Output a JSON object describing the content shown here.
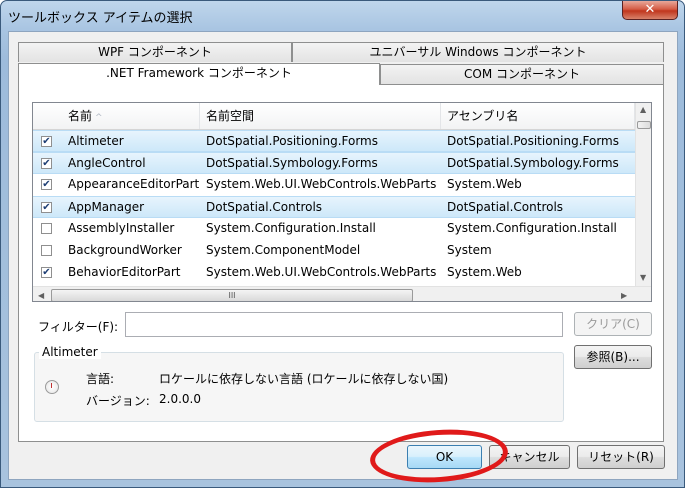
{
  "window": {
    "title": "ツールボックス アイテムの選択",
    "close_label": "✕"
  },
  "tabs": {
    "row1": [
      {
        "label": "WPF コンポーネント"
      },
      {
        "label": "ユニバーサル Windows コンポーネント"
      }
    ],
    "row2": [
      {
        "label": ".NET Framework コンポーネント",
        "active": true
      },
      {
        "label": "COM コンポーネント"
      }
    ]
  },
  "list": {
    "columns": [
      "名前",
      "名前空間",
      "アセンブリ名"
    ],
    "sort_indicator": "^",
    "rows": [
      {
        "checked": true,
        "selected": true,
        "name": "Altimeter",
        "namespace": "DotSpatial.Positioning.Forms",
        "assembly": "DotSpatial.Positioning.Forms"
      },
      {
        "checked": true,
        "selected": true,
        "name": "AngleControl",
        "namespace": "DotSpatial.Symbology.Forms",
        "assembly": "DotSpatial.Symbology.Forms"
      },
      {
        "checked": true,
        "selected": false,
        "name": "AppearanceEditorPart",
        "namespace": "System.Web.UI.WebControls.WebParts",
        "assembly": "System.Web"
      },
      {
        "checked": true,
        "selected": true,
        "name": "AppManager",
        "namespace": "DotSpatial.Controls",
        "assembly": "DotSpatial.Controls"
      },
      {
        "checked": false,
        "selected": false,
        "name": "AssemblyInstaller",
        "namespace": "System.Configuration.Install",
        "assembly": "System.Configuration.Install"
      },
      {
        "checked": false,
        "selected": false,
        "name": "BackgroundWorker",
        "namespace": "System.ComponentModel",
        "assembly": "System"
      },
      {
        "checked": true,
        "selected": false,
        "name": "BehaviorEditorPart",
        "namespace": "System.Web.UI.WebControls.WebParts",
        "assembly": "System.Web"
      }
    ],
    "hscroll_grip": "III"
  },
  "filter": {
    "label": "フィルター(F):",
    "value": "",
    "clear_label": "クリア(C)"
  },
  "details": {
    "group_label": "Altimeter",
    "language_label": "言語:",
    "language_value": "ロケールに依存しない言語 (ロケールに依存しない国)",
    "version_label": "バージョン:",
    "version_value": "2.0.0.0"
  },
  "buttons": {
    "browse": "参照(B)...",
    "ok": "OK",
    "cancel": "キャンセル",
    "reset": "リセット(R)"
  },
  "colors": {
    "highlight_ellipse": "#e01a1a",
    "selected_row": "#cde8f9"
  }
}
